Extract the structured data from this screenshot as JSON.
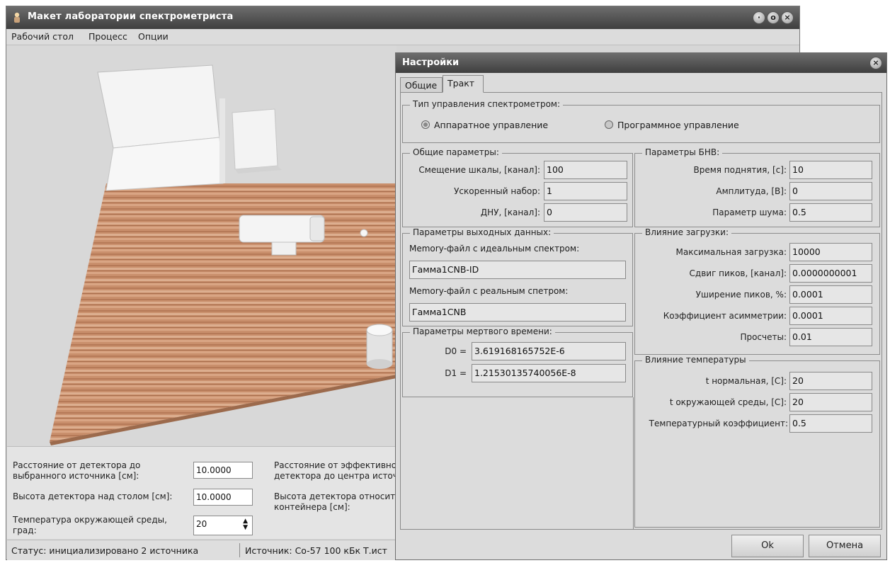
{
  "main_window": {
    "title": "Макет лаборатории спектрометриста",
    "menu": [
      "Рабочий стол",
      "Процесс",
      "Опции"
    ]
  },
  "params": {
    "distance_label": "Расстояние от детектора до выбранного источника [см]:",
    "distance_value": "10.0000",
    "height_label": "Высота детектора над столом [см]:",
    "height_value": "10.0000",
    "temp_label": "Температура окружающей среды, град:",
    "temp_value": "20",
    "eff_distance_label": "Расстояние от эффективного центра детектора до центра источника [см]:",
    "rel_height_label": "Высота детектора относительно дна контейнера [см]:"
  },
  "status": {
    "left": "Статус: инициализировано 2 источника",
    "right": "Источник: Co-57 100 кБк Т.ист"
  },
  "dialog": {
    "title": "Настройки",
    "tabs": [
      "Общие",
      "Тракт"
    ],
    "control_type": {
      "title": "Тип управления спектрометром:",
      "hardware": "Аппаратное управление",
      "software": "Программное управление"
    },
    "common": {
      "title": "Общие параметры:",
      "rows": [
        {
          "label": "Смещение шкалы, [канал]:",
          "value": "100"
        },
        {
          "label": "Ускоренный набор:",
          "value": "1"
        },
        {
          "label": "ДНУ, [канал]:",
          "value": "0"
        }
      ]
    },
    "output": {
      "title": "Параметры выходных данных:",
      "ideal_label": "Memory-файл с идеальным спектром:",
      "ideal_value": "Гамма1CNB-ID",
      "real_label": "Memory-файл с реальным спетром:",
      "real_value": "Гамма1CNB"
    },
    "deadtime": {
      "title": "Параметры мертвого времени:",
      "rows": [
        {
          "label": "D0 =",
          "value": "3.619168165752E-6"
        },
        {
          "label": "D1 =",
          "value": "1.21530135740056E-8"
        }
      ]
    },
    "bnv": {
      "title": "Параметры БНВ:",
      "rows": [
        {
          "label": "Время поднятия, [с]:",
          "value": "10"
        },
        {
          "label": "Амплитуда, [В]:",
          "value": "0"
        },
        {
          "label": "Параметр шума:",
          "value": "0.5"
        }
      ]
    },
    "load": {
      "title": "Влияние загрузки:",
      "rows": [
        {
          "label": "Максимальная загрузка:",
          "value": "10000"
        },
        {
          "label": "Сдвиг пиков, [канал]:",
          "value": "0.0000000001"
        },
        {
          "label": "Уширение пиков, %:",
          "value": "0.0001"
        },
        {
          "label": "Коэффициент асимметрии:",
          "value": "0.0001"
        },
        {
          "label": "Просчеты:",
          "value": "0.01"
        }
      ]
    },
    "temperature": {
      "title": "Влияние температуры",
      "rows": [
        {
          "label": "t нормальная, [С]:",
          "value": "20"
        },
        {
          "label": "t окружающей среды, [С]:",
          "value": "20"
        },
        {
          "label": "Температурный коэффициент:",
          "value": "0.5"
        }
      ]
    },
    "ok_label": "Ok",
    "cancel_label": "Отмена"
  }
}
